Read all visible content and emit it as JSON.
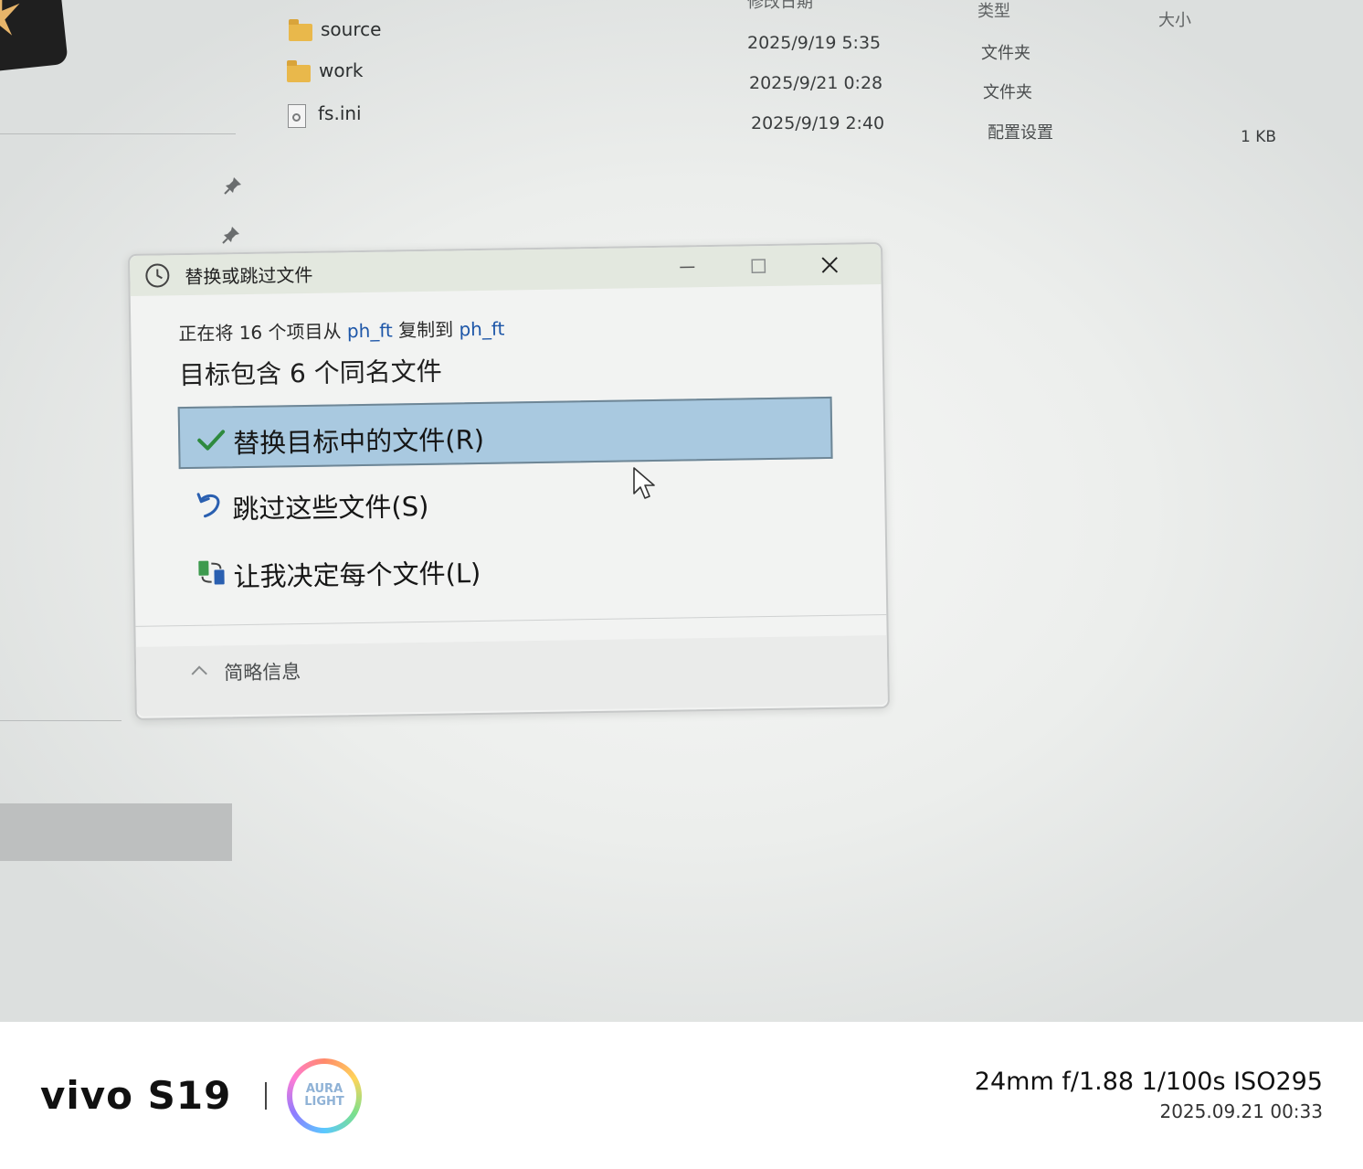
{
  "explorer": {
    "columns": {
      "date": "修改日期",
      "type": "类型",
      "size": "大小"
    },
    "files": [
      {
        "name": "source",
        "date": "2025/9/19 5:35",
        "type": "文件夹",
        "size": "",
        "icon": "folder-icon"
      },
      {
        "name": "work",
        "date": "2025/9/21 0:28",
        "type": "文件夹",
        "size": "",
        "icon": "folder-icon"
      },
      {
        "name": "fs.ini",
        "date": "2025/9/19 2:40",
        "type": "配置设置",
        "size": "1 KB",
        "icon": "ini-file-icon"
      }
    ]
  },
  "dialog": {
    "title": "替换或跳过文件",
    "copy_message": {
      "prefix": "正在将 16 个项目从 ",
      "source": "ph_ft",
      "middle": " 复制到 ",
      "dest": "ph_ft"
    },
    "conflict_message": "目标包含 6 个同名文件",
    "options": [
      {
        "label": "替换目标中的文件(R)",
        "icon": "checkmark-icon",
        "selected": true
      },
      {
        "label": "跳过这些文件(S)",
        "icon": "skip-arrow-icon",
        "selected": false
      },
      {
        "label": "让我决定每个文件(L)",
        "icon": "compare-files-icon",
        "selected": false
      }
    ],
    "footer_toggle": "简略信息",
    "accent_color": "#a9c9e0"
  },
  "watermark": {
    "brand": "vivo S19",
    "aura_line1": "AURA",
    "aura_line2": "LIGHT",
    "params": "24mm  f/1.88  1/100s  ISO295",
    "timestamp": "2025.09.21 00:33"
  }
}
